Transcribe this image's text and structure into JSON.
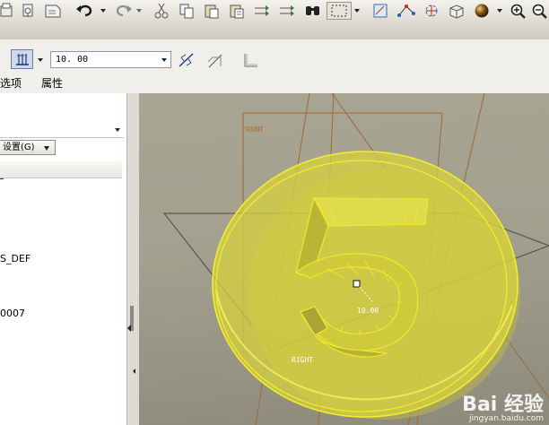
{
  "panel": {
    "depth_value": "10. 00",
    "tabs": [
      "选项",
      "属性"
    ]
  },
  "model_tree": {
    "settings_label": "设置(G)",
    "items": [
      "S_DEF",
      "0007"
    ]
  },
  "viewport": {
    "datum_front": "FRONT",
    "datum_right": "RIGHT",
    "dimension": "10.00"
  },
  "watermark": {
    "main": "Bai 经验",
    "sub": "jingyan.baidu.com"
  },
  "colors": {
    "selection_yellow": "#e8e41c",
    "datum_edge": "#9c6a3a",
    "background": "#a6a291"
  }
}
